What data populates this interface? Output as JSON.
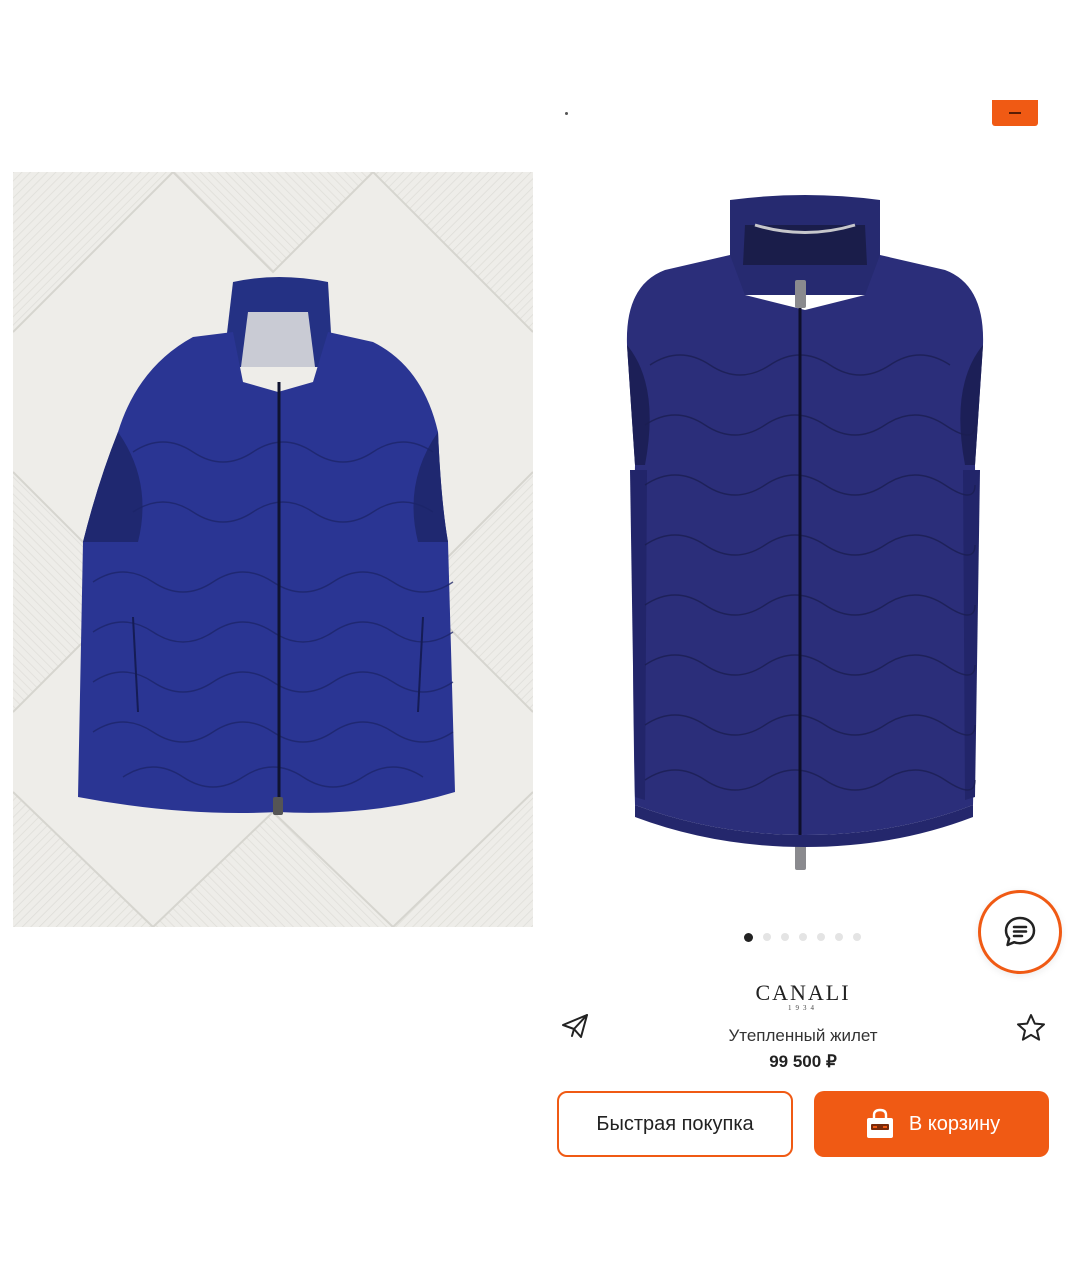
{
  "gallery": {
    "slide_count": 7,
    "active_slide": 1
  },
  "brand": {
    "name": "CANALI",
    "year": "1934"
  },
  "product": {
    "name": "Утепленный жилет",
    "price": "99 500 ₽"
  },
  "actions": {
    "quick_buy_label": "Быстрая покупка",
    "add_to_cart_label": "В корзину"
  },
  "icons": {
    "share": "paper-plane-icon",
    "favorite": "star-outline-icon",
    "chat": "chat-bubble-icon",
    "cart": "shopping-bag-icon"
  },
  "colors": {
    "accent": "#f05a14",
    "vest_navy": "#2a3593",
    "vest_dark_navy": "#27296e"
  }
}
